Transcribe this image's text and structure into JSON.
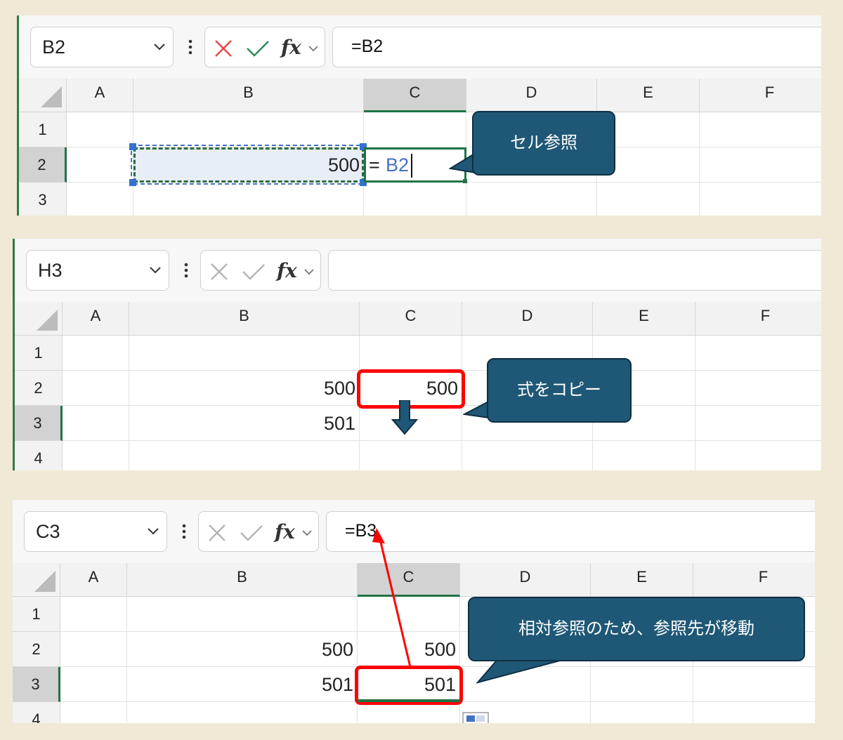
{
  "columns": [
    "A",
    "B",
    "C",
    "D",
    "E",
    "F"
  ],
  "panel1": {
    "name_box": "B2",
    "formula": "=B2",
    "rows": [
      "1",
      "2",
      "3"
    ],
    "cell_b2": "500",
    "cell_c2_prefix": "=",
    "cell_c2_ref": "B2",
    "callout": "セル参照"
  },
  "panel2": {
    "name_box": "H3",
    "formula": "",
    "rows": [
      "1",
      "2",
      "3",
      "4"
    ],
    "cell_b2": "500",
    "cell_c2": "500",
    "cell_b3": "501",
    "callout": "式をコピー"
  },
  "panel3": {
    "name_box": "C3",
    "formula": "=B3",
    "rows": [
      "1",
      "2",
      "3",
      "4"
    ],
    "cell_b2": "500",
    "cell_c2": "500",
    "cell_b3": "501",
    "cell_c3": "501",
    "callout": "相対参照のため、参照先が移動"
  },
  "colors": {
    "callout_bg": "#1f5876",
    "excel_green": "#217346",
    "highlight_red": "#ff0000",
    "ref_blue": "#4472c4"
  }
}
